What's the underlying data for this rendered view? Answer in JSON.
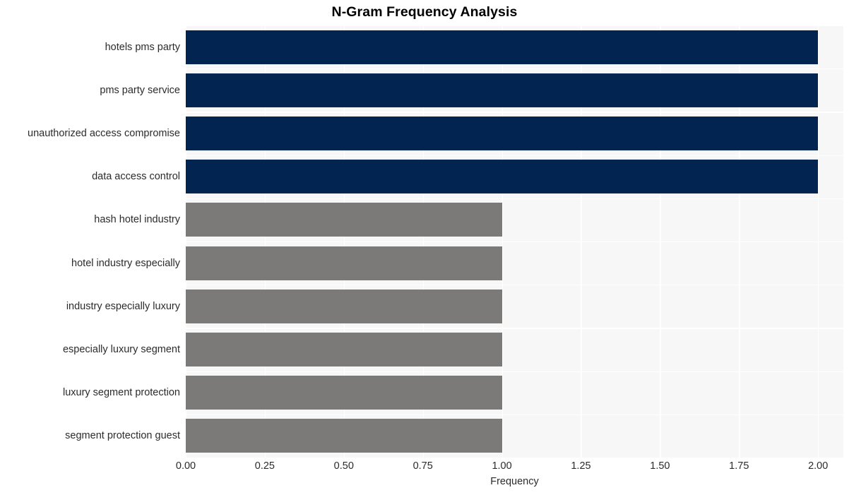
{
  "chart_data": {
    "type": "bar",
    "orientation": "horizontal",
    "title": "N-Gram Frequency Analysis",
    "xlabel": "Frequency",
    "ylabel": "",
    "categories": [
      "hotels pms party",
      "pms party service",
      "unauthorized access compromise",
      "data access control",
      "hash hotel industry",
      "hotel industry especially",
      "industry especially luxury",
      "especially luxury segment",
      "luxury segment protection",
      "segment protection guest"
    ],
    "values": [
      2,
      2,
      2,
      2,
      1,
      1,
      1,
      1,
      1,
      1
    ],
    "bar_colors": [
      "#012450",
      "#012450",
      "#012450",
      "#012450",
      "#7b7a78",
      "#7b7a78",
      "#7b7a78",
      "#7b7a78",
      "#7b7a78",
      "#7b7a78"
    ],
    "xlim": [
      0.0,
      2.08
    ],
    "xticks": [
      0.0,
      0.25,
      0.5,
      0.75,
      1.0,
      1.25,
      1.5,
      1.75,
      2.0
    ],
    "xtick_labels": [
      "0.00",
      "0.25",
      "0.50",
      "0.75",
      "1.00",
      "1.25",
      "1.50",
      "1.75",
      "2.00"
    ],
    "grid": true,
    "grid_color": "#ffffff",
    "plot_background": "#f7f7f7",
    "figure_background": "#ffffff",
    "legend": null,
    "legend_position": "none"
  }
}
